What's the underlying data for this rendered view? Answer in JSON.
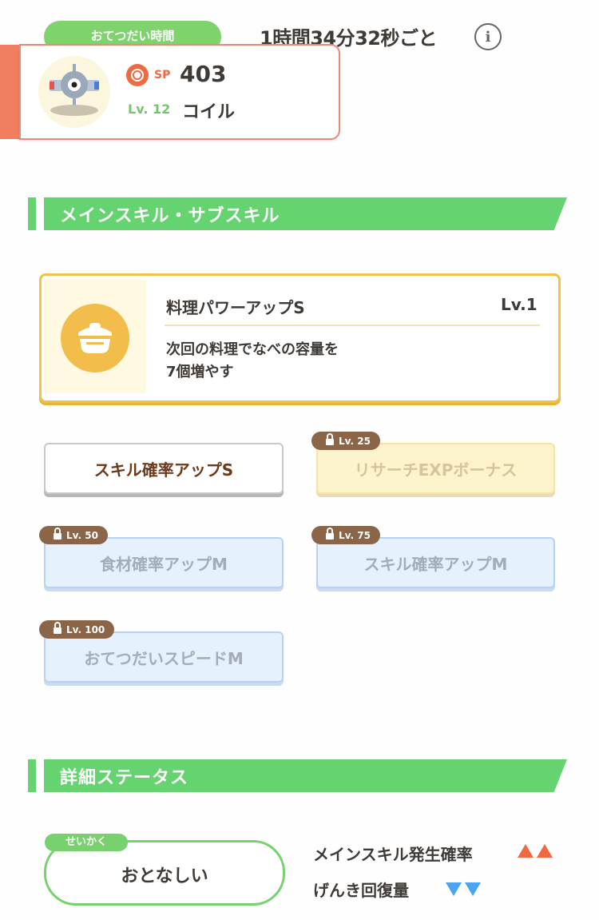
{
  "helper": {
    "label": "おてつだい時間",
    "time": "1時間34分32秒ごと"
  },
  "pokemon": {
    "sp_label": "SP",
    "sp_value": "403",
    "level": "Lv. 12",
    "name": "コイル"
  },
  "sections": {
    "skills_title": "メインスキル・サブスキル",
    "status_title": "詳細ステータス"
  },
  "main_skill": {
    "name": "料理パワーアップS",
    "level": "Lv.1",
    "description": "次回の料理でなべの容量を\n7個増やす"
  },
  "sub_skills": [
    {
      "label": "スキル確率アップS",
      "locked": false,
      "unlock_level": ""
    },
    {
      "label": "リサーチEXPボーナス",
      "locked": true,
      "unlock_level": "Lv. 25"
    },
    {
      "label": "食材確率アップM",
      "locked": true,
      "unlock_level": "Lv. 50"
    },
    {
      "label": "スキル確率アップM",
      "locked": true,
      "unlock_level": "Lv. 75"
    },
    {
      "label": "おてつだいスピードM",
      "locked": true,
      "unlock_level": "Lv. 100"
    }
  ],
  "nature": {
    "tag": "せいかく",
    "value": "おとなしい",
    "up_effect": "メインスキル発生確率",
    "down_effect": "げんき回復量"
  },
  "colors": {
    "green": "#66d371",
    "orange": "#ef6a42",
    "blue": "#4da3ef",
    "gold": "#f0c24a",
    "brown": "#8a6548"
  }
}
